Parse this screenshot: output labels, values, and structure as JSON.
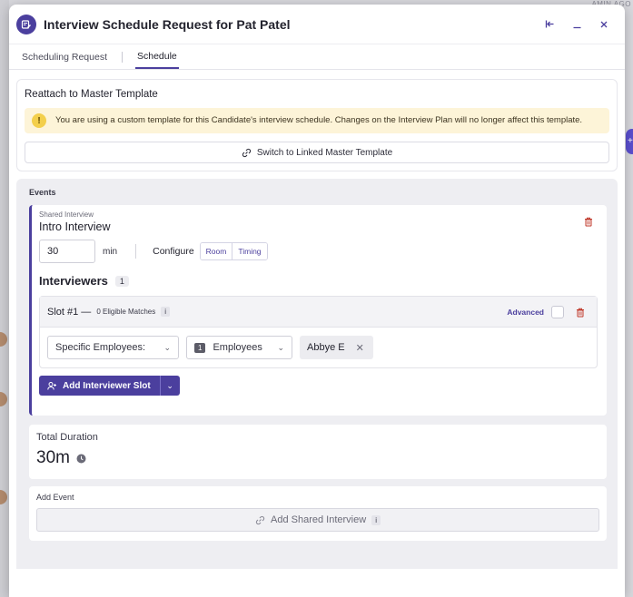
{
  "background": {
    "top_right_text": "AMIN AGO",
    "right_pill_text": "+"
  },
  "modal": {
    "title": "Interview Schedule Request for Pat Patel",
    "tabs": [
      {
        "label": "Scheduling Request",
        "active": false
      },
      {
        "label": "Schedule",
        "active": true
      }
    ]
  },
  "reattach": {
    "title": "Reattach to Master Template",
    "warning": "You are using a custom template for this Candidate's interview schedule. Changes on the Interview Plan will no longer affect this template.",
    "switch_button": "Switch to Linked Master Template"
  },
  "events": {
    "label": "Events",
    "event": {
      "kind": "Shared Interview",
      "title": "Intro Interview",
      "duration_value": "30",
      "duration_unit": "min",
      "configure_label": "Configure",
      "configure_options": [
        "Room",
        "Timing"
      ],
      "interviewers_title": "Interviewers",
      "interviewers_count": "1",
      "slot": {
        "title": "Slot #1 —",
        "matches": "0 Eligible Matches",
        "info": "i",
        "advanced_label": "Advanced",
        "type_select": "Specific Employees:",
        "employees_count": "1",
        "employees_label": "Employees",
        "selected_person": "Abbye E"
      },
      "add_slot_button": "Add Interviewer Slot"
    }
  },
  "total": {
    "label": "Total Duration",
    "value": "30m"
  },
  "add_event": {
    "label": "Add Event",
    "button": "Add Shared Interview",
    "info": "i"
  },
  "colors": {
    "brand": "#4b3f9e",
    "warning_bg": "#fdf4d8",
    "danger": "#c0392b"
  }
}
